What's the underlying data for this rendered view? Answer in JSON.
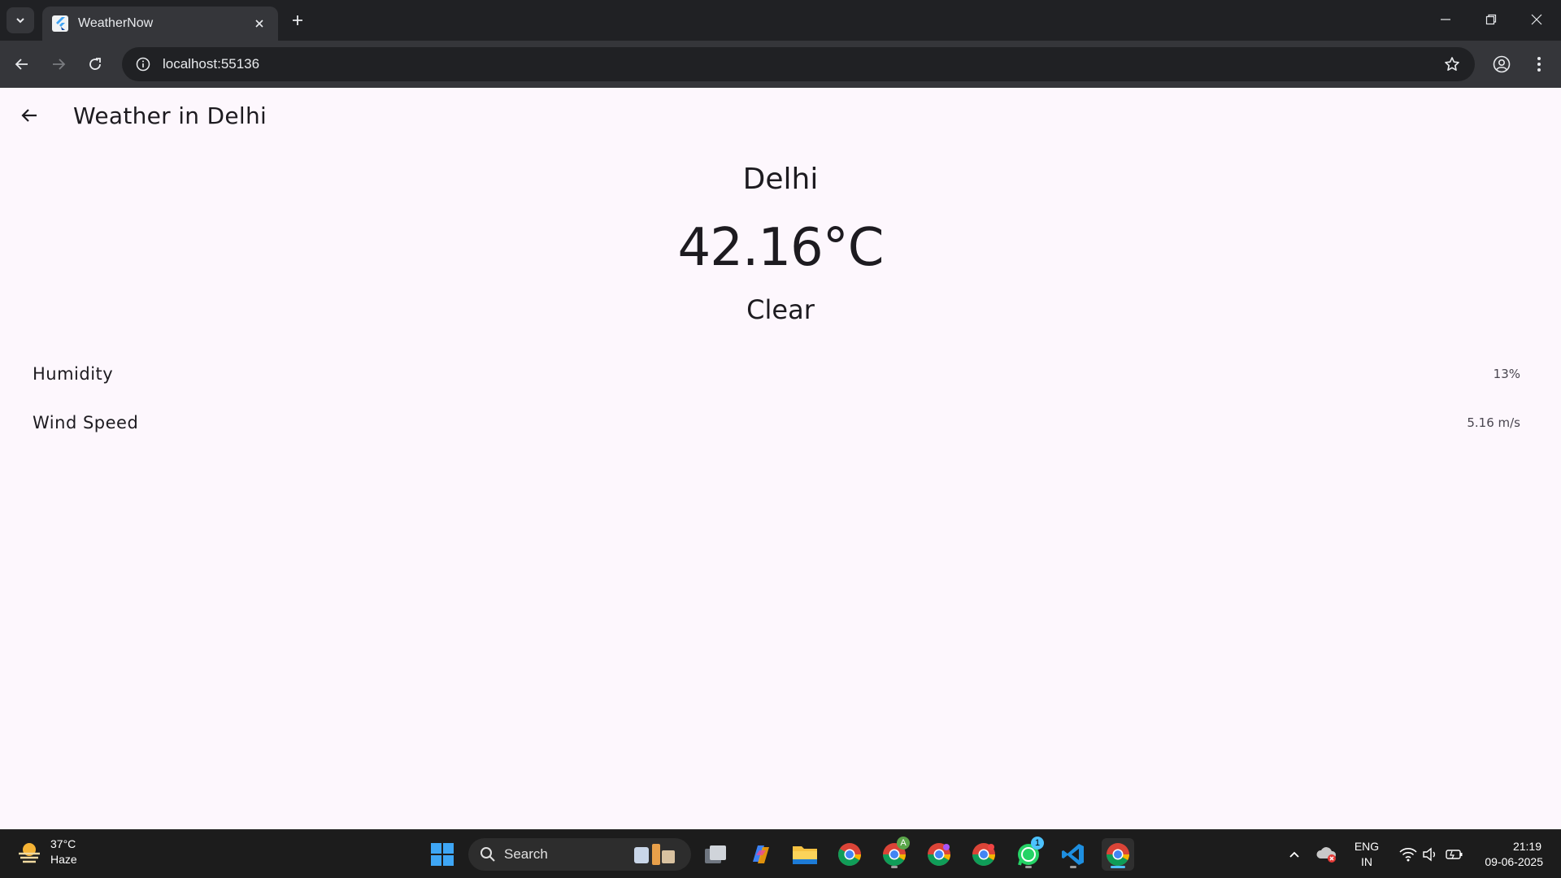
{
  "browser": {
    "tab_title": "WeatherNow",
    "url": "localhost:55136"
  },
  "app": {
    "page_title": "Weather in Delhi",
    "city": "Delhi",
    "temperature": "42.16°C",
    "condition": "Clear",
    "details": [
      {
        "label": "Humidity",
        "value": "13%"
      },
      {
        "label": "Wind Speed",
        "value": "5.16 m/s"
      }
    ],
    "background_color": "#fdf7fd"
  },
  "taskbar": {
    "weather_temp": "37°C",
    "weather_desc": "Haze",
    "search_label": "Search",
    "language_line1": "ENG",
    "language_line2": "IN",
    "time": "21:19",
    "date": "09-06-2025",
    "whatsapp_badge": "1",
    "chrome_profile_badge": "A"
  },
  "colors": {
    "accent": "#4cc2ff",
    "chrome_dark": "#202124",
    "chrome_toolbar": "#35363a"
  }
}
